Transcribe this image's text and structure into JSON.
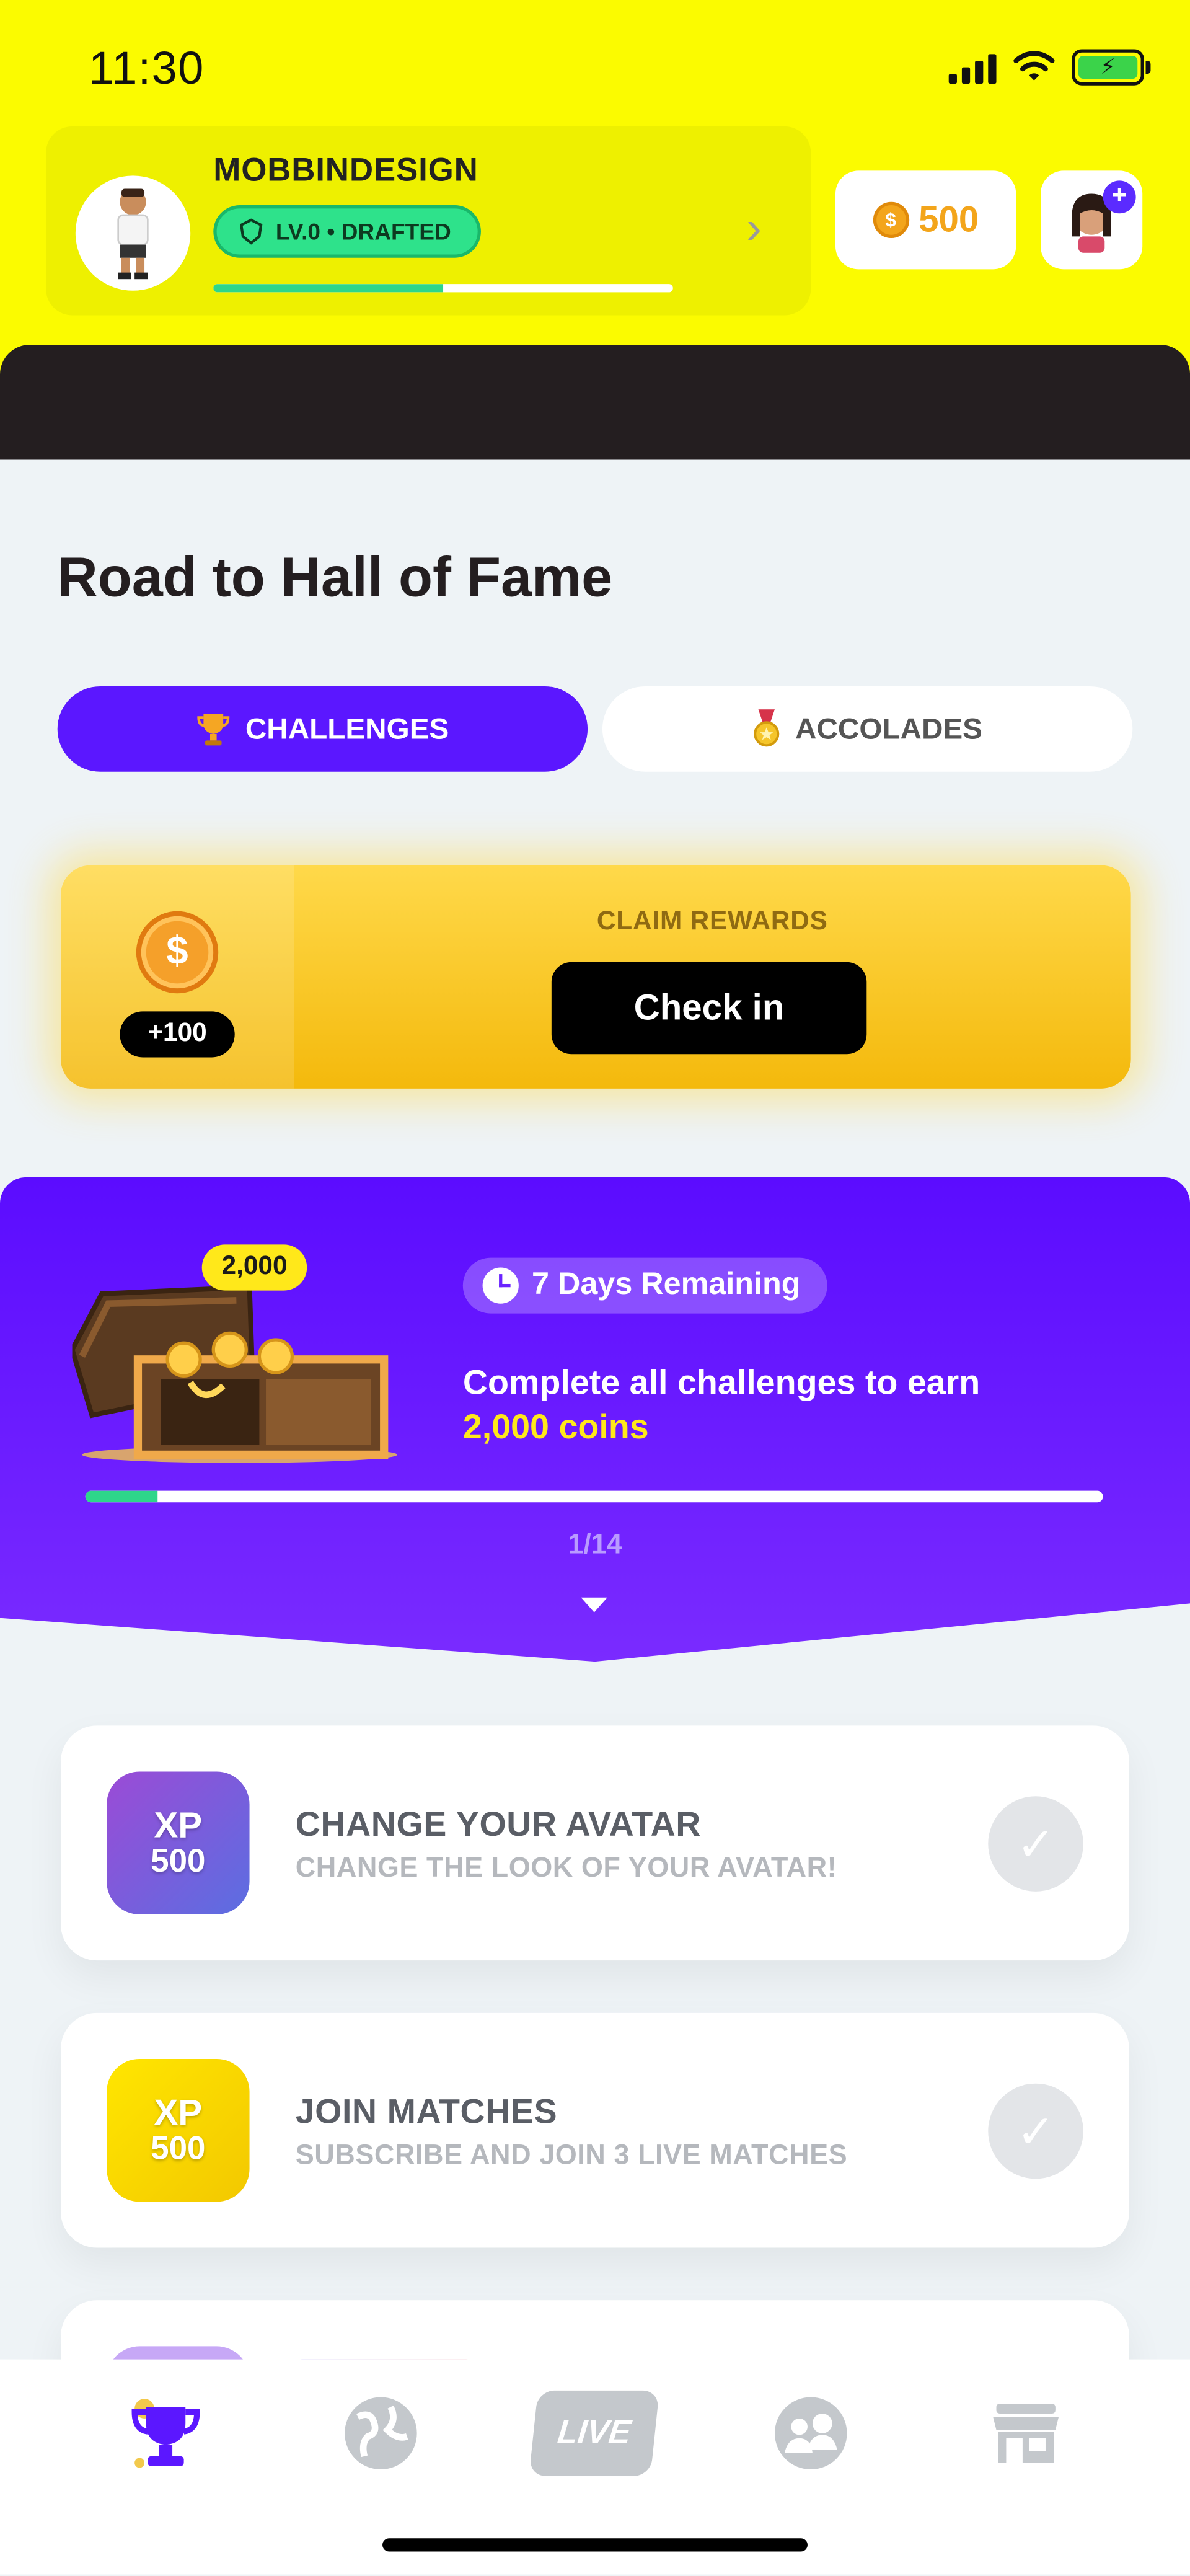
{
  "status_bar": {
    "time": "11:30"
  },
  "header": {
    "username": "MOBBINDESIGN",
    "level_badge": "LV.0 • DRAFTED",
    "coins": "500",
    "xp_progress": 0.5
  },
  "page": {
    "title": "Road to Hall of Fame"
  },
  "tabs": [
    {
      "label": "CHALLENGES",
      "icon": "trophy-icon",
      "active": true
    },
    {
      "label": "ACCOLADES",
      "icon": "medal-icon",
      "active": false
    }
  ],
  "claim": {
    "reward": "+100",
    "label": "CLAIM REWARDS",
    "button": "Check in"
  },
  "challenge_panel": {
    "chest_amount": "2,000",
    "days_remaining": "7 Days Remaining",
    "headline": "Complete all challenges to earn",
    "highlight": "2,000 coins",
    "progress_label": "1/14",
    "progress_value": 1,
    "progress_total": 14
  },
  "tasks": [
    {
      "xp_label": "XP",
      "xp_amount": "500",
      "title": "CHANGE YOUR AVATAR",
      "subtitle": "CHANGE THE LOOK OF YOUR AVATAR!",
      "tile_color": "#8a55dc"
    },
    {
      "xp_label": "XP",
      "xp_amount": "500",
      "title": "JOIN MATCHES",
      "subtitle": "SUBSCRIBE AND JOIN 3 LIVE MATCHES",
      "tile_color": "#fbe400"
    }
  ],
  "tabbar": {
    "items": [
      {
        "icon": "trophy-icon",
        "active": true
      },
      {
        "icon": "globe-icon",
        "active": false
      },
      {
        "icon": "live-icon",
        "label": "LIVE",
        "active": false
      },
      {
        "icon": "friends-icon",
        "active": false
      },
      {
        "icon": "store-icon",
        "active": false
      }
    ]
  },
  "colors": {
    "header_bg": "#fbfb00",
    "accent_purple": "#5b17ff",
    "gold": "#f4b90c",
    "green": "#2ed68a"
  }
}
